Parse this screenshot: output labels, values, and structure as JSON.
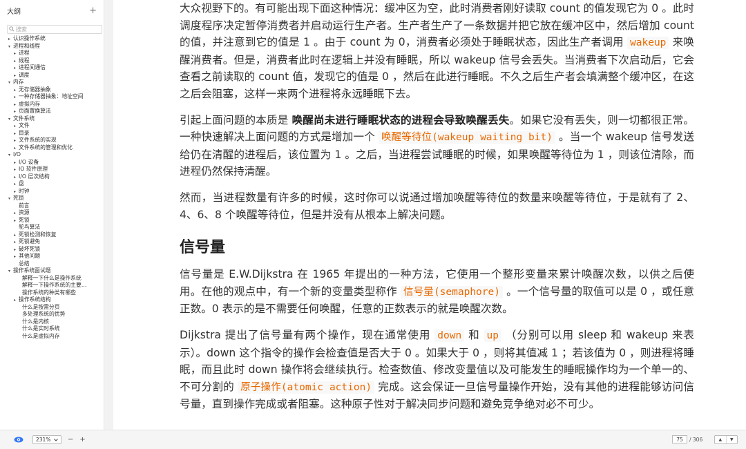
{
  "sidebar": {
    "title": "大纲",
    "add_label": "+",
    "search_placeholder": "搜索",
    "items": [
      {
        "label": "认识操作系统",
        "level": "l1",
        "arrow": "▸"
      },
      {
        "label": "进程和线程",
        "level": "l1",
        "arrow": "▾"
      },
      {
        "label": "进程",
        "level": "l2",
        "arrow": "▸"
      },
      {
        "label": "线程",
        "level": "l2",
        "arrow": "▸"
      },
      {
        "label": "进程间通信",
        "level": "l2",
        "arrow": "▸"
      },
      {
        "label": "调度",
        "level": "l2",
        "arrow": "▸"
      },
      {
        "label": "内存",
        "level": "l1",
        "arrow": "▾"
      },
      {
        "label": "无存储器抽象",
        "level": "l2",
        "arrow": "▸"
      },
      {
        "label": "一种存储器抽象：地址空间",
        "level": "l2",
        "arrow": "▸"
      },
      {
        "label": "虚拟内存",
        "level": "l2",
        "arrow": "▸"
      },
      {
        "label": "页面置换算法",
        "level": "l2",
        "arrow": "▸"
      },
      {
        "label": "文件系统",
        "level": "l1",
        "arrow": "▾"
      },
      {
        "label": "文件",
        "level": "l2",
        "arrow": "▸"
      },
      {
        "label": "目录",
        "level": "l2",
        "arrow": "▸"
      },
      {
        "label": "文件系统的实现",
        "level": "l2",
        "arrow": "▸"
      },
      {
        "label": "文件系统的管理和优化",
        "level": "l2",
        "arrow": "▸"
      },
      {
        "label": "I/O",
        "level": "l1",
        "arrow": "▾"
      },
      {
        "label": "I/O 设备",
        "level": "l2",
        "arrow": "▸"
      },
      {
        "label": "IO 软件原理",
        "level": "l2",
        "arrow": "▸"
      },
      {
        "label": "I/O 层次结构",
        "level": "l2",
        "arrow": "▸"
      },
      {
        "label": "盘",
        "level": "l2",
        "arrow": "▸"
      },
      {
        "label": "时钟",
        "level": "l2",
        "arrow": "▸"
      },
      {
        "label": "死锁",
        "level": "l1",
        "arrow": "▾"
      },
      {
        "label": "前言",
        "level": "l2n",
        "arrow": ""
      },
      {
        "label": "资源",
        "level": "l2",
        "arrow": "▸"
      },
      {
        "label": "死锁",
        "level": "l2",
        "arrow": "▸"
      },
      {
        "label": "鸵鸟算法",
        "level": "l2n",
        "arrow": ""
      },
      {
        "label": "死锁检测和恢复",
        "level": "l2",
        "arrow": "▸"
      },
      {
        "label": "死锁避免",
        "level": "l2",
        "arrow": "▸"
      },
      {
        "label": "破坏死锁",
        "level": "l2",
        "arrow": "▸"
      },
      {
        "label": "其他问题",
        "level": "l2",
        "arrow": "▸"
      },
      {
        "label": "总结",
        "level": "l2n",
        "arrow": ""
      },
      {
        "label": "操作系统面试题",
        "level": "l1",
        "arrow": "▾"
      },
      {
        "label": "解释一下什么是操作系统",
        "level": "l3n",
        "arrow": ""
      },
      {
        "label": "解释一下操作系统的主要…",
        "level": "l3n",
        "arrow": ""
      },
      {
        "label": "操作系统的种类有哪些",
        "level": "l3n",
        "arrow": ""
      },
      {
        "label": "操作系统结构",
        "level": "l2",
        "arrow": "▸"
      },
      {
        "label": "什么是按需分页",
        "level": "l3n",
        "arrow": ""
      },
      {
        "label": "多处理系统的优势",
        "level": "l3n",
        "arrow": ""
      },
      {
        "label": "什么是内核",
        "level": "l3n",
        "arrow": ""
      },
      {
        "label": "什么是实时系统",
        "level": "l3n",
        "arrow": ""
      },
      {
        "label": "什么是虚拟内存",
        "level": "l3n",
        "arrow": ""
      }
    ]
  },
  "content": {
    "p1": [
      {
        "t": "text",
        "v": "大众视野下的。有可能出现下面这种情况：缓冲区为空，此时消费者刚好读取 count 的值发现它为 0 。此时调度程序决定暂停消费者并启动运行生产者。生产者生产了一条数据并把它放在缓冲区中，然后增加 count 的值，并注意到它的值是 1 。由于 count 为 0，消费者必须处于睡眠状态，因此生产者调用 "
      },
      {
        "t": "code",
        "v": "wakeup"
      },
      {
        "t": "text",
        "v": " 来唤醒消费者。但是，消费者此时在逻辑上并没有睡眠，所以 wakeup 信号会丢失。当消费者下次启动后，它会查看之前读取的 count 值，发现它的值是 0 ，然后在此进行睡眠。不久之后生产者会填满整个缓冲区，在这之后会阻塞，这样一来两个进程将永远睡眠下去。"
      }
    ],
    "p2": [
      {
        "t": "text",
        "v": "引起上面问题的本质是 "
      },
      {
        "t": "bold",
        "v": "唤醒尚未进行睡眠状态的进程会导致唤醒丢失"
      },
      {
        "t": "text",
        "v": "。如果它没有丢失，则一切都很正常。一种快速解决上面问题的方式是增加一个 "
      },
      {
        "t": "code",
        "v": "唤醒等待位(wakeup waiting bit)"
      },
      {
        "t": "text",
        "v": " 。当一个 wakeup 信号发送给仍在清醒的进程后，该位置为 1 。之后，当进程尝试睡眠的时候，如果唤醒等待位为 1 ，则该位清除，而进程仍然保持清醒。"
      }
    ],
    "p3": [
      {
        "t": "text",
        "v": "然而，当进程数量有许多的时候，这时你可以说通过增加唤醒等待位的数量来唤醒等待位，于是就有了 2、4、6、8 个唤醒等待位，但是并没有从根本上解决问题。"
      }
    ],
    "heading": "信号量",
    "p4": [
      {
        "t": "text",
        "v": "信号量是 E.W.Dijkstra 在 1965 年提出的一种方法，它使用一个整形变量来累计唤醒次数，以供之后使用。在他的观点中，有一个新的变量类型称作 "
      },
      {
        "t": "code",
        "v": "信号量(semaphore)"
      },
      {
        "t": "text",
        "v": " 。一个信号量的取值可以是 0 ，或任意正数。0 表示的是不需要任何唤醒，任意的正数表示的就是唤醒次数。"
      }
    ],
    "p5": [
      {
        "t": "text",
        "v": "Dijkstra 提出了信号量有两个操作，现在通常使用 "
      },
      {
        "t": "code",
        "v": "down"
      },
      {
        "t": "text",
        "v": " 和 "
      },
      {
        "t": "code",
        "v": "up"
      },
      {
        "t": "text",
        "v": " （分别可以用 sleep 和 wakeup 来表示）。down 这个指令的操作会检查值是否大于 0 。如果大于 0 ，则将其值减 1 ；若该值为 0 ，则进程将睡眠，而且此时 down 操作将会继续执行。检查数值、修改变量值以及可能发生的睡眠操作均为一个单一的、不可分割的 "
      },
      {
        "t": "code",
        "v": "原子操作(atomic action)"
      },
      {
        "t": "text",
        "v": " 完成。这会保证一旦信号量操作开始，没有其他的进程能够访问信号量，直到操作完成或者阻塞。这种原子性对于解决同步问题和避免竞争绝对必不可少。"
      }
    ]
  },
  "bottombar": {
    "zoom": "231%",
    "zoom_out": "−",
    "zoom_in": "+",
    "page_current": "75",
    "page_total": "/ 306",
    "prev": "▲",
    "next": "▼"
  },
  "colors": {
    "code_text": "#e96900",
    "accent_eye": "#3478f6"
  }
}
